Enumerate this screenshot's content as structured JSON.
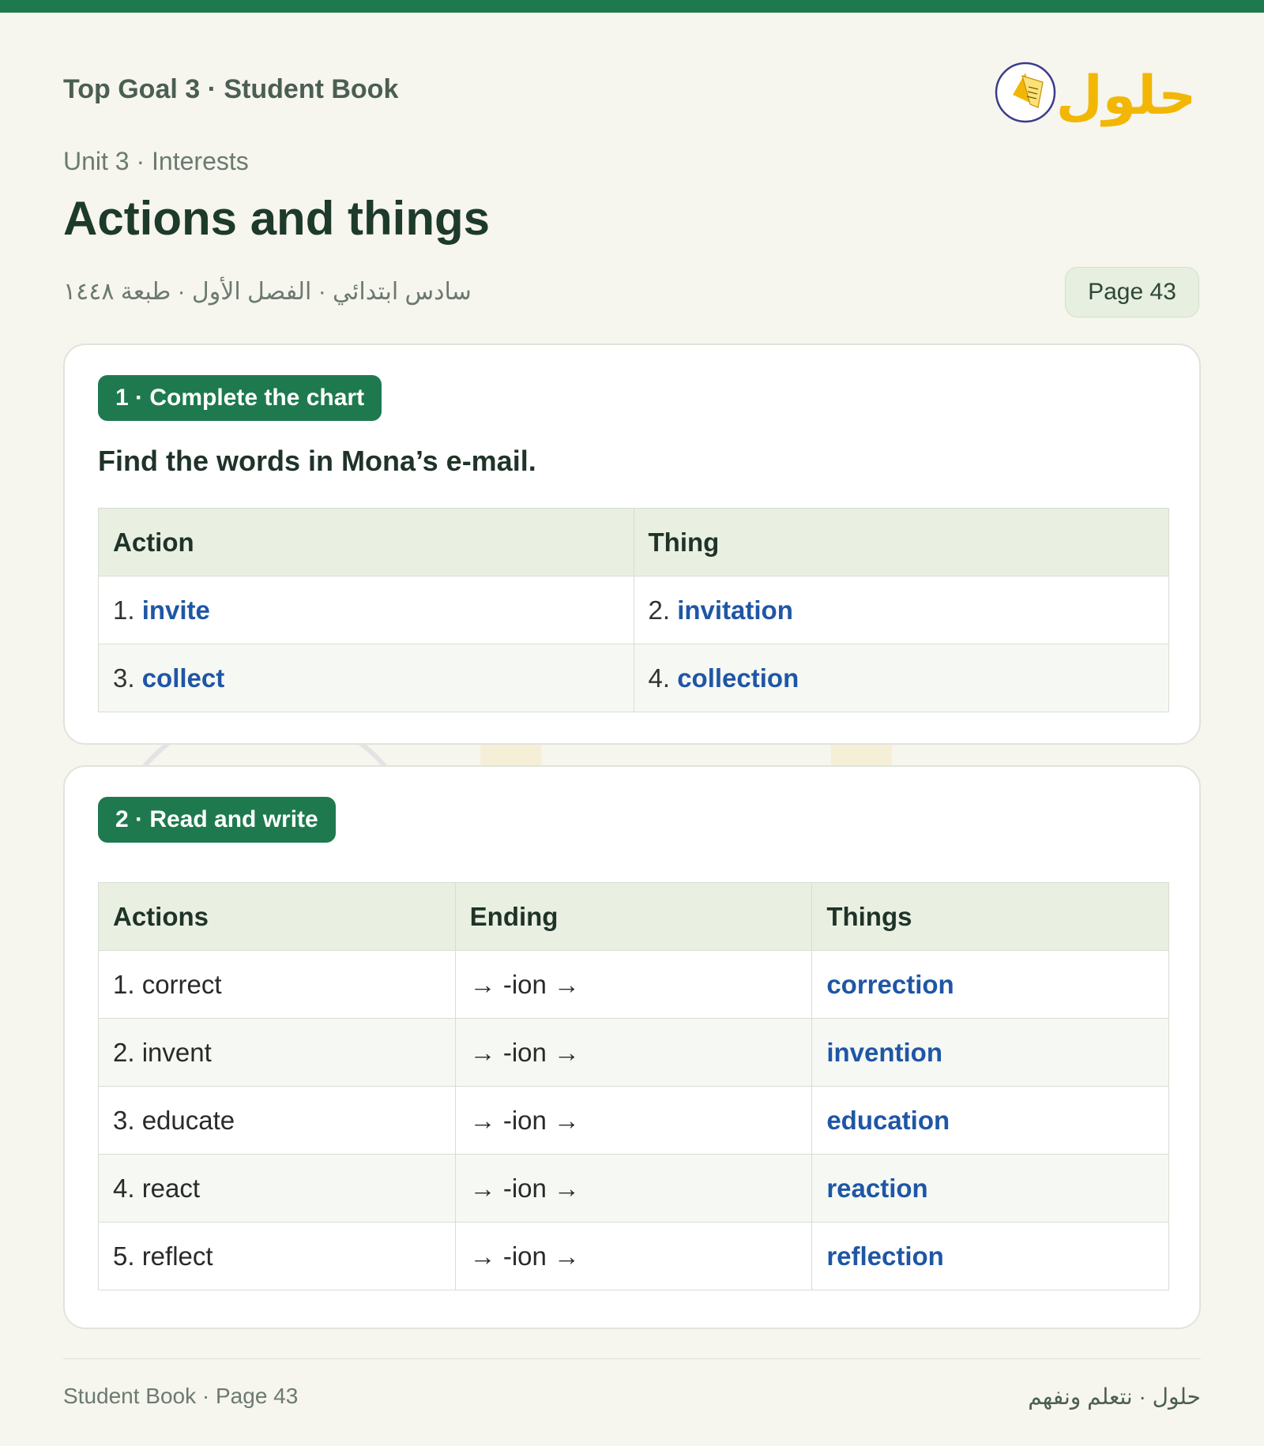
{
  "header": {
    "book_title": "Top Goal 3 · Student Book",
    "unit": "Unit 3 · Interests",
    "title": "Actions and things",
    "arabic_meta": "سادس ابتدائي · الفصل الأول · طبعة ١٤٤٨",
    "page_badge": "Page 43",
    "logo_text": "حلول"
  },
  "section1": {
    "pill": "1 · Complete the chart",
    "instruction": "Find the words in Mona’s e-mail.",
    "headers": [
      "Action",
      "Thing"
    ],
    "rows": [
      [
        {
          "num": "1.",
          "word": "invite"
        },
        {
          "num": "2.",
          "word": "invitation"
        }
      ],
      [
        {
          "num": "3.",
          "word": "collect"
        },
        {
          "num": "4.",
          "word": "collection"
        }
      ]
    ]
  },
  "section2": {
    "pill": "2 · Read and write",
    "headers": [
      "Actions",
      "Ending",
      "Things"
    ],
    "rows": [
      {
        "action": "1. correct",
        "ending": "→ -ion →",
        "thing": "correction"
      },
      {
        "action": "2. invent",
        "ending": "→ -ion →",
        "thing": "invention"
      },
      {
        "action": "3. educate",
        "ending": "→ -ion →",
        "thing": "education"
      },
      {
        "action": "4. react",
        "ending": "→ -ion →",
        "thing": "reaction"
      },
      {
        "action": "5. reflect",
        "ending": "→ -ion →",
        "thing": "reflection"
      }
    ]
  },
  "footer": {
    "left": "Student Book · Page 43",
    "right": "حلول · نتعلم ونفهم"
  },
  "colors": {
    "brand_green": "#1e7a4e",
    "answer_blue": "#1f56a6",
    "logo_gold": "#f2b705",
    "header_cell": "#e9f0e2"
  }
}
